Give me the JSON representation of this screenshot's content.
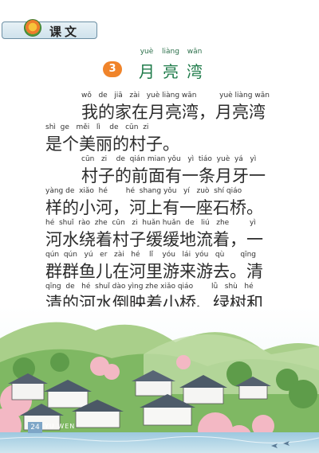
{
  "header": {
    "section_label": "课文",
    "icon": "flower-badge-icon"
  },
  "title": {
    "number": "3",
    "pinyin": [
      "yuè",
      "liàng",
      "wān"
    ],
    "text": [
      "月",
      "亮",
      "湾"
    ]
  },
  "lines": [
    {
      "pinyin": "wǒ   de   jiā   zài   yuè liàng wān          yuè liàng wān",
      "text": "我的家在月亮湾，月亮湾",
      "indent": true
    },
    {
      "pinyin": "shì  ge   měi   lì    de   cūn  zi",
      "text": "是个美丽的村子。",
      "indent": false
    },
    {
      "pinyin": "cūn   zi    de  qián mian yǒu   yì  tiáo  yuè  yá   yì",
      "text": "村子的前面有一条月牙一",
      "indent": true
    },
    {
      "pinyin": "yàng de  xiǎo  hé        hé  shang yǒu   yí   zuò  shí qiáo",
      "text": "样的小河，河上有一座石桥。",
      "indent": false
    },
    {
      "pinyin": "hé  shuǐ  rào  zhe  cūn   zi  huǎn huǎn  de   liú   zhe         yì",
      "text": "河水绕着村子缓缓地流着，一",
      "indent": false
    },
    {
      "pinyin": "qún  qún   yú   er   zài   hé    lǐ    yóu   lái  yóu   qù       qīng",
      "text": "群群鱼儿在河里游来游去。清",
      "indent": false
    },
    {
      "pinyin": "qīng  de   hé  shuǐ dào yìng zhe xiǎo qiáo        lǜ   shù   hé",
      "text": "清的河水倒映着小桥、绿树和",
      "indent": false
    }
  ],
  "footer": {
    "page_number": "24",
    "label": "YU WEN"
  },
  "colors": {
    "accent": "#f0842a",
    "title": "#1f7b4a",
    "tab_border": "#6d8fa4"
  }
}
